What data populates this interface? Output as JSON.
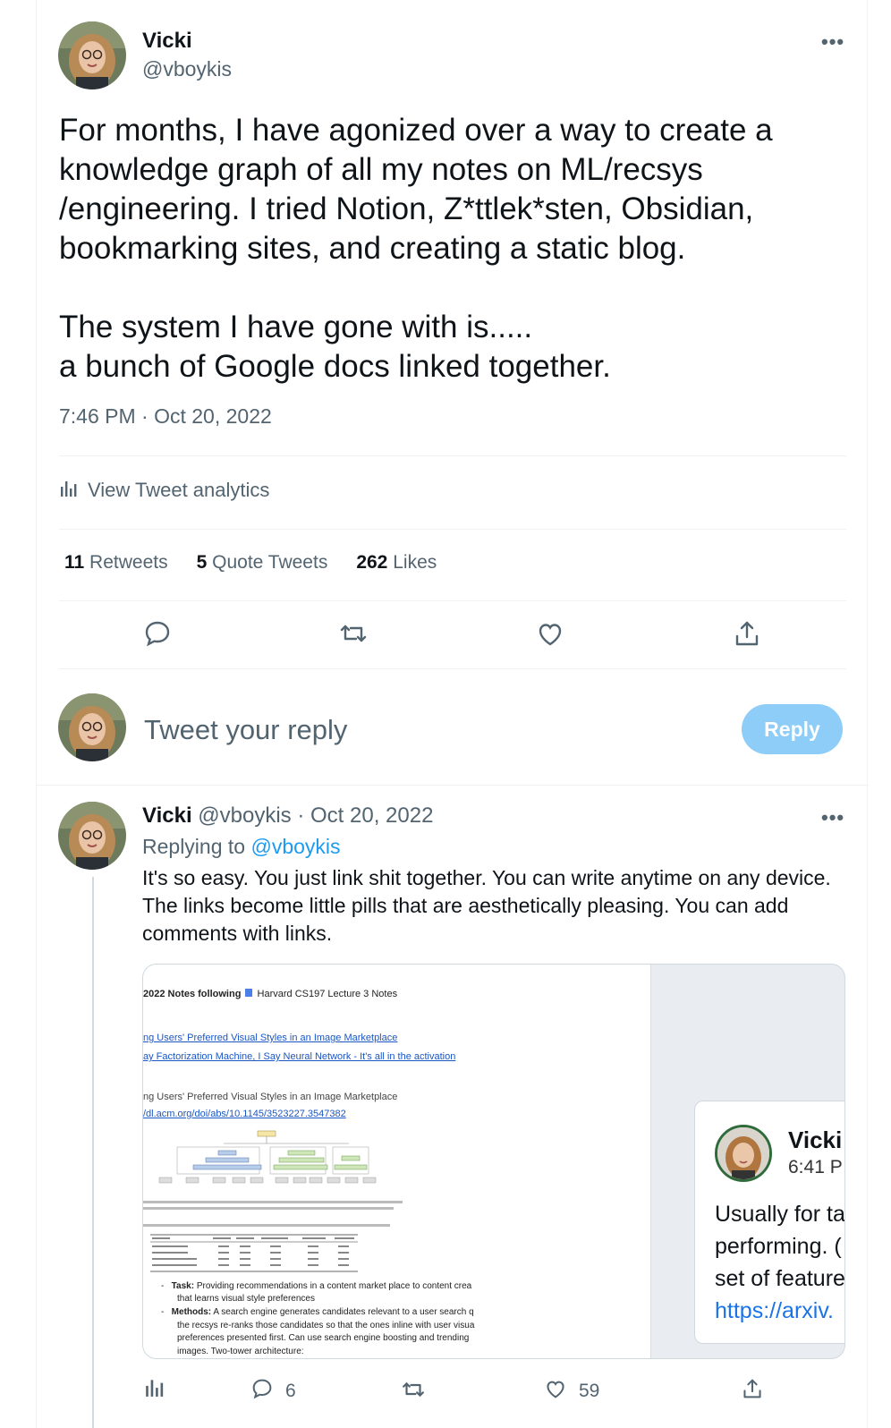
{
  "main_tweet": {
    "author_name": "Vicki",
    "author_handle": "@vboykis",
    "more_label": "•••",
    "text": "For months, I have agonized over a way to create a\nknowledge graph of all my notes on ML/recsys\n/engineering. I tried Notion, Z*ttlek*sten, Obsidian,\nbookmarking sites, and creating a static blog.\n\nThe system I have gone with is.....\na bunch of Google docs linked together.",
    "timestamp": "7:46 PM · Oct 20, 2022",
    "analytics_label": "View Tweet analytics",
    "stats": {
      "retweets_count": "11",
      "retweets_label": "Retweets",
      "quotes_count": "5",
      "quotes_label": "Quote Tweets",
      "likes_count": "262",
      "likes_label": "Likes"
    }
  },
  "reply_box": {
    "placeholder": "Tweet your reply",
    "button_label": "Reply"
  },
  "reply_tweet": {
    "author_name": "Vicki",
    "author_handle": "@vboykis",
    "date": "· Oct 20, 2022",
    "more_label": "•••",
    "replying_prefix": "Replying to",
    "replying_handle": "@vboykis",
    "text": "It's so easy. You just link shit together. You can write anytime on any device. The links become little pills that are aesthetically pleasing. You can add comments with links.",
    "media": {
      "doc_title": "2022 Notes following",
      "doc_chip": "Harvard CS197 Lecture 3 Notes",
      "doc_link_1": "ng Users' Preferred Visual Styles in an Image Marketplace",
      "doc_link_2": "ay Factorization Machine, I Say Neural Network - It's all in the activation",
      "doc_heading": "ng Users' Preferred Visual Styles in an Image Marketplace",
      "doc_url": "/dl.acm.org/doi/abs/10.1145/3523227.3547382",
      "doc_bullet_1_label": "Task:",
      "doc_bullet_1_text": "Providing recommendations in a content market place to content crea",
      "doc_bullet_1_text2": "that learns visual style preferences",
      "doc_bullet_2_label": "Methods:",
      "doc_bullet_2_text": "A search engine generates candidates relevant to a user search q",
      "doc_bullet_2_text2": "the recsys re-ranks those candidates so that the ones inline with user visua",
      "doc_bullet_2_text3": "preferences presented first. Can use search engine boosting and trending",
      "doc_bullet_2_text4": "images. Two-tower architecture:",
      "comment_name": "Vicki",
      "comment_time": "6:41 P",
      "comment_text": "Usually for ta\nperforming. (\nset of feature",
      "comment_link": "https://arxiv."
    },
    "actions": {
      "reply_count": "6",
      "like_count": "59"
    }
  },
  "colors": {
    "accent": "#1d9bf0",
    "reply_button_disabled": "#8ecdf8",
    "secondary_text": "#536471"
  }
}
